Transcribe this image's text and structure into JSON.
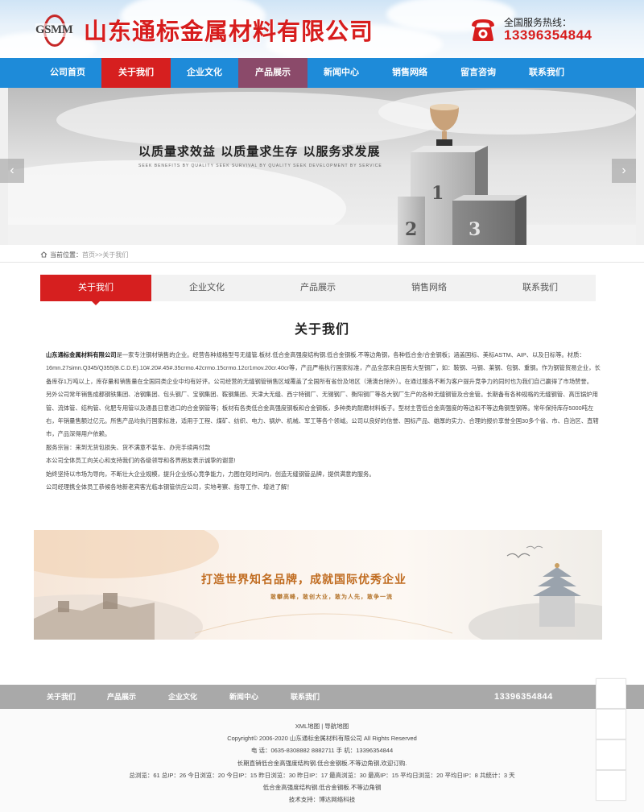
{
  "header": {
    "logo_text": "GSMM",
    "company_name": "山东通标金属材料有限公司",
    "hotline_label": "全国服务热线：",
    "hotline_number": "13396354844"
  },
  "nav": {
    "items": [
      {
        "label": "公司首页"
      },
      {
        "label": "关于我们",
        "active": true
      },
      {
        "label": "企业文化"
      },
      {
        "label": "产品展示"
      },
      {
        "label": "新闻中心"
      },
      {
        "label": "销售网络"
      },
      {
        "label": "留言咨询"
      },
      {
        "label": "联系我们"
      }
    ],
    "colors": {
      "bar": "#1e8bd9",
      "active": "#d61f1f",
      "hover": "#8b4a6a"
    }
  },
  "banner": {
    "slogan": "以质量求效益 以质量求生存 以服务求发展",
    "subtitle": "SEEK BENEFITS BY QUALITY SEEK SURVIVAL BY QUALITY SEEK DEVELOPMENT BY SERVICE",
    "podium_numbers": [
      "1",
      "2",
      "3"
    ],
    "prev_icon": "chevron-left-icon",
    "next_icon": "chevron-right-icon"
  },
  "breadcrumb": {
    "label": "当前位置：",
    "home": "首页",
    "separator": ">>",
    "current": "关于我们"
  },
  "tabs": {
    "items": [
      {
        "label": "关于我们",
        "active": true
      },
      {
        "label": "企业文化"
      },
      {
        "label": "产品展示"
      },
      {
        "label": "销售网络"
      },
      {
        "label": "联系我们"
      }
    ]
  },
  "section_title": "关于我们",
  "article": {
    "company_bold": "山东通标金属材料有限公司",
    "p1": "是一家专注钢材销售的企业。经营各种规格型号无缝管.板材.低合金高强度结构钢.低合金钢板.不等边角钢，各种低合金/合金钢板；涵盖国标、美标ASTM、AIP、以及日标等。材质：16mn.27simn.Q345/Q355(B.C.D.E).10#.20#.45#.35crmo.42crmo.15crmo.12cr1mov.20cr.40cr等，产品严格执行国家标准，产品全部来自国有大型钢厂，如：鞍钢、马钢、莱钢、包钢、重钢。作为钢管贸易企业，长备库存1万吨以上，库存量和销售量在全国同类企业中均有好评。公司经营的无缝钢管销售区域覆盖了全国所有省份及地区（港澳台除外）。在通过服务不断为客户提升竞争力的同时也为我们自己赢得了市场赞誉。",
    "p2": "另外公司常年销售成都钢铁集团、冶钢集团、包头钢厂、宝钢集团、鞍钢集团、天津大无缝、西宁特钢厂、无锡钢厂、衡阳钢厂等各大钢厂生产的各种无缝钢管及合金管。长期备有各种规格的无缝钢管、高压锅炉用管、流体管、结构管、化肥专用管以及通县日意进口的合金钢管等；板材有各类低合金高强度钢板和合金钢板，多种类的耐磨材料板子。型材主营低合金高强度的等边和不等边角钢型钢等。常年保持库存5000吨左右，年销量售额过亿元。所售产品均执行国家标准，适用于工程、煤矿、纺织、电力、锅炉、机械、军工等各个领域。公司以良好的信誉、国标产品、雄厚的实力、合理的报价享誉全国30多个省、市、自治区、直辖市，产品深得用户依赖。",
    "p3": "服务宗旨：来到无货包损失、货不满意不装车、办完手续再付款",
    "p4": "本公司全体员工向关心和支持我们的各级领导和各界朋友表示诚挚的谢意!",
    "p5": "始终坚持以市场为导向，不断壮大企业规模，提升企业核心竞争能力，力图在短时间内，创造无缝钢管品牌，提供满意的服务。",
    "p6": "公司经理携全体员工恭候各地新老宾客光临本钢管供应公司，实地考察、指导工作、增进了解！"
  },
  "promo": {
    "title": "打造世界知名品牌，成就国际优秀企业",
    "subtitle": "敢攀高峰，敢创大业，敢为人先，敢争一流"
  },
  "footer_nav": {
    "items": [
      {
        "label": "关于我们"
      },
      {
        "label": "产品展示"
      },
      {
        "label": "企业文化"
      },
      {
        "label": "新闻中心"
      },
      {
        "label": "联系我们"
      }
    ],
    "phone": "13396354844"
  },
  "footer": {
    "links": {
      "xml": "XML地图",
      "sep": " | ",
      "nav": "导航地图"
    },
    "copyright": "Copyright© 2006-2020 山东通标金属材料有限公司 All Rights Reserved",
    "contact": "电  话：0635-8308882 8882711 手  机：13396354844",
    "slogan": "长期直销低合金高强度结构钢.低合金钢板.不等边角钢,欢迎订购.",
    "stats": "总浏览：61 总IP：26 今日浏览：20 今日IP：15 昨日浏览：30 昨日IP：17 最高浏览：30 最高IP：15 平均日浏览：20 平均日IP：8 共统计：3 天",
    "keywords": "低合金高强度结构钢.低合金钢板.不等边角钢",
    "support": "技术支持：博达网络科技"
  }
}
